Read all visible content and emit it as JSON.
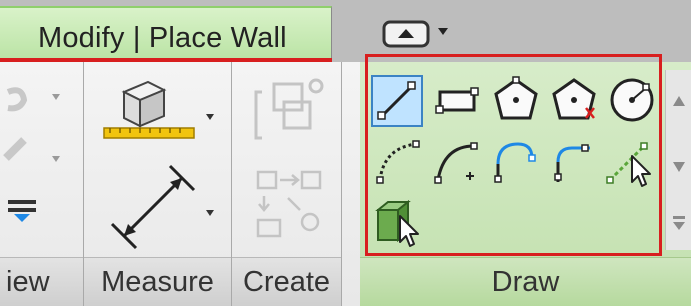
{
  "tab": {
    "label": "Modify | Place Wall"
  },
  "panels": {
    "view": {
      "title": "iew"
    },
    "measure": {
      "title": "Measure"
    },
    "create": {
      "title": "Create"
    },
    "draw": {
      "title": "Draw"
    }
  },
  "colors": {
    "highlight_red": "#d81f1f",
    "draw_panel_green": "#c2e0ae",
    "tool_selected": "#bfe3ff",
    "tool_blue": "#1e88e5",
    "tool_green": "#5aa63a",
    "measure_yellow": "#f1c40f"
  }
}
